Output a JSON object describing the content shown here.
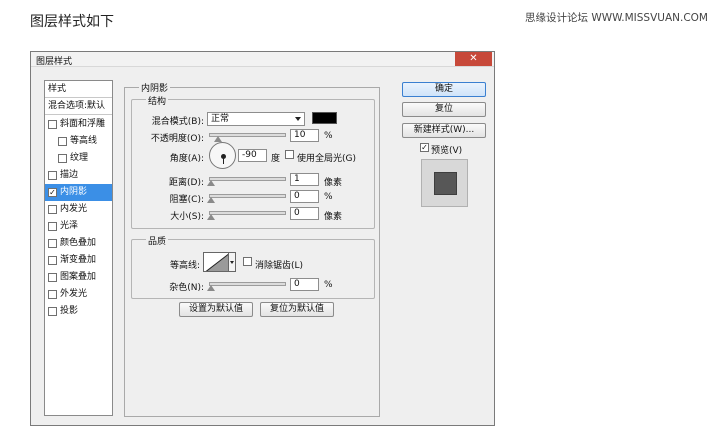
{
  "page_title": "图层样式如下",
  "watermark": "思缘设计论坛 WWW.MISSVUAN.COM",
  "dialog": {
    "title": "图层样式",
    "close_glyph": "✕",
    "style_list": {
      "header": "样式",
      "blend_options": "混合选项:默认",
      "items": [
        {
          "label": "斜面和浮雕",
          "checked": false,
          "indent": false
        },
        {
          "label": "等高线",
          "checked": false,
          "indent": true
        },
        {
          "label": "纹理",
          "checked": false,
          "indent": true
        },
        {
          "label": "描边",
          "checked": false,
          "indent": false
        },
        {
          "label": "内阴影",
          "checked": true,
          "indent": false,
          "selected": true
        },
        {
          "label": "内发光",
          "checked": false,
          "indent": false
        },
        {
          "label": "光泽",
          "checked": false,
          "indent": false
        },
        {
          "label": "颜色叠加",
          "checked": false,
          "indent": false
        },
        {
          "label": "渐变叠加",
          "checked": false,
          "indent": false
        },
        {
          "label": "图案叠加",
          "checked": false,
          "indent": false
        },
        {
          "label": "外发光",
          "checked": false,
          "indent": false
        },
        {
          "label": "投影",
          "checked": false,
          "indent": false
        }
      ]
    },
    "panel": {
      "title": "内阴影",
      "structure": {
        "title": "结构",
        "blend_mode_label": "混合模式(B):",
        "blend_mode_value": "正常",
        "shadow_color": "#000000",
        "opacity_label": "不透明度(O):",
        "opacity_value": "10",
        "opacity_unit": "%",
        "opacity_level": 10,
        "angle_label": "角度(A):",
        "angle_value": "-90",
        "angle_unit": "度",
        "global_light_label": "使用全局光(G)",
        "global_light_checked": false,
        "distance_label": "距离(D):",
        "distance_value": "1",
        "distance_unit": "像素",
        "choke_label": "阻塞(C):",
        "choke_value": "0",
        "choke_unit": "%",
        "size_label": "大小(S):",
        "size_value": "0",
        "size_unit": "像素"
      },
      "quality": {
        "title": "品质",
        "contour_label": "等高线:",
        "anti_alias_label": "消除锯齿(L)",
        "anti_alias_checked": false,
        "noise_label": "杂色(N):",
        "noise_value": "0",
        "noise_unit": "%"
      },
      "set_default_button": "设置为默认值",
      "reset_default_button": "复位为默认值"
    },
    "buttons": {
      "ok": "确定",
      "reset": "复位",
      "new_style": "新建样式(W)...",
      "preview_label": "预览(V)",
      "preview_checked": true
    },
    "check_glyph": "✓",
    "colors": {
      "selection": "#3b8fe6",
      "preview_swatch": "#575757",
      "close_button": "#c7493a"
    }
  }
}
